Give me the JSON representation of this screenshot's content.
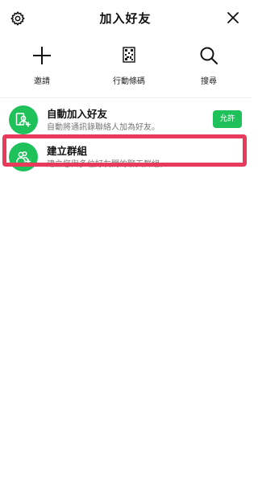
{
  "header": {
    "title": "加入好友",
    "settings_icon": "gear-icon",
    "close_icon": "close-icon"
  },
  "actions": [
    {
      "label": "邀請",
      "icon": "plus-icon"
    },
    {
      "label": "行動條碼",
      "icon": "qr-code-icon"
    },
    {
      "label": "搜尋",
      "icon": "search-icon"
    }
  ],
  "auto_add": {
    "name": "自動加入好友",
    "description": "自動將通訊錄聯絡人加為好友。",
    "button_label": "允許",
    "icon": "contact-add-icon"
  },
  "create_group": {
    "name": "建立群組",
    "description": "建立您與多位好友間的聊天群組。",
    "icon": "group-add-icon"
  },
  "colors": {
    "accent": "#1ec15a",
    "highlight": "#e83a5a"
  }
}
